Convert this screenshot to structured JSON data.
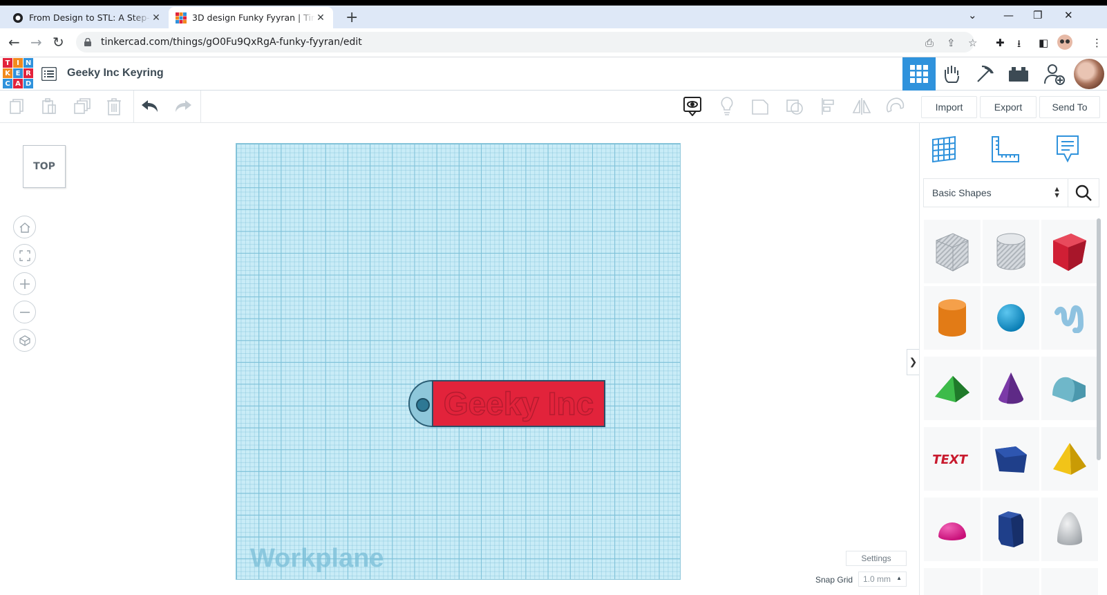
{
  "browser": {
    "tabs": [
      {
        "title": "From Design to STL: A Step-by-St",
        "close": "✕"
      },
      {
        "title": "3D design Funky Fyyran | Tinkercad",
        "close": "✕"
      }
    ],
    "new_tab": "+",
    "url": "tinkercad.com/things/gO0Fu9QxRgA-funky-fyyran/edit"
  },
  "app": {
    "logo": [
      "T",
      "I",
      "N",
      "K",
      "E",
      "R",
      "C",
      "A",
      "D"
    ],
    "design_title": "Geeky Inc Keyring",
    "header_icons": [
      "grid-view-icon",
      "tinker-hand-icon",
      "minecraft-pickaxe-icon",
      "lego-brick-icon",
      "add-user-icon"
    ]
  },
  "edit_toolbar": {
    "import_label": "Import",
    "export_label": "Export",
    "send_to_label": "Send To"
  },
  "viewport": {
    "view_cube_label": "TOP",
    "workplane_label": "Workplane",
    "object_text": "Geeky Inc",
    "settings_label": "Settings",
    "snap_grid_label": "Snap Grid",
    "snap_grid_value": "1.0 mm",
    "collapse_glyph": "❯"
  },
  "panel": {
    "category": "Basic Shapes",
    "shapes": [
      "box-hole-shape",
      "cylinder-hole-shape",
      "box-shape",
      "cylinder-shape",
      "sphere-shape",
      "scribble-shape",
      "roof-shape",
      "cone-shape",
      "round-roof-shape",
      "text-shape",
      "polygon-shape",
      "pyramid-shape",
      "half-sphere-shape",
      "hexagonal-prism-shape",
      "paraboloid-shape"
    ]
  },
  "colors": {
    "accent": "#2f92dc",
    "workplane": "#c9ecf7",
    "object_red": "#e2233b"
  }
}
